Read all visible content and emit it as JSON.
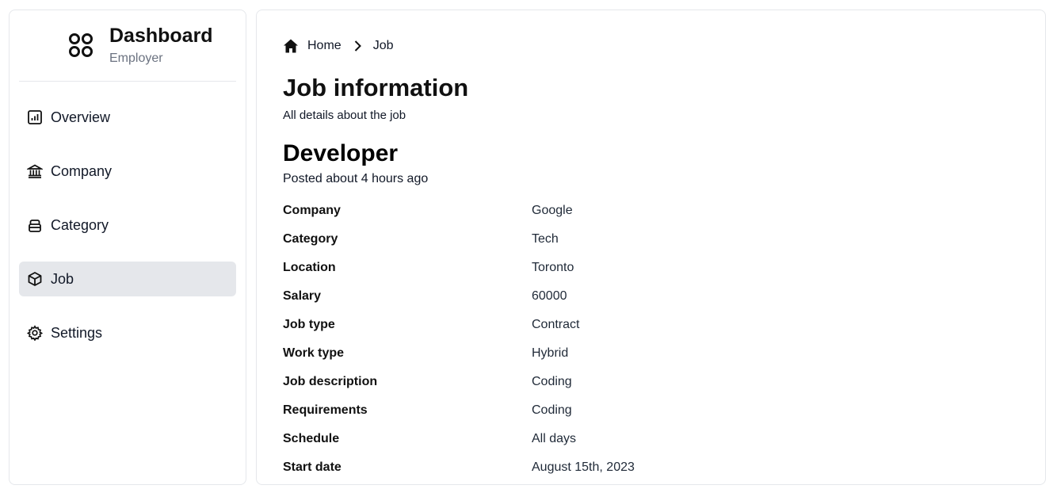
{
  "sidebar": {
    "brand": {
      "title": "Dashboard",
      "subtitle": "Employer"
    },
    "items": [
      {
        "label": "Overview",
        "icon": "bar-chart-icon",
        "active": false
      },
      {
        "label": "Company",
        "icon": "building-icon",
        "active": false
      },
      {
        "label": "Category",
        "icon": "archive-icon",
        "active": false
      },
      {
        "label": "Job",
        "icon": "package-icon",
        "active": true
      },
      {
        "label": "Settings",
        "icon": "gear-icon",
        "active": false
      }
    ]
  },
  "breadcrumb": {
    "home": "Home",
    "current": "Job"
  },
  "page": {
    "title": "Job information",
    "subtitle": "All details about the job"
  },
  "job": {
    "title": "Developer",
    "posted": "Posted about 4 hours ago",
    "details": [
      {
        "label": "Company",
        "value": "Google"
      },
      {
        "label": "Category",
        "value": "Tech"
      },
      {
        "label": "Location",
        "value": "Toronto"
      },
      {
        "label": "Salary",
        "value": "60000"
      },
      {
        "label": "Job type",
        "value": "Contract"
      },
      {
        "label": "Work type",
        "value": "Hybrid"
      },
      {
        "label": "Job description",
        "value": "Coding"
      },
      {
        "label": "Requirements",
        "value": "Coding"
      },
      {
        "label": "Schedule",
        "value": "All days"
      },
      {
        "label": "Start date",
        "value": "August 15th, 2023"
      }
    ]
  },
  "colors": {
    "active_bg": "#e5e7eb",
    "border": "#e5e7eb",
    "muted": "#6b7280"
  }
}
